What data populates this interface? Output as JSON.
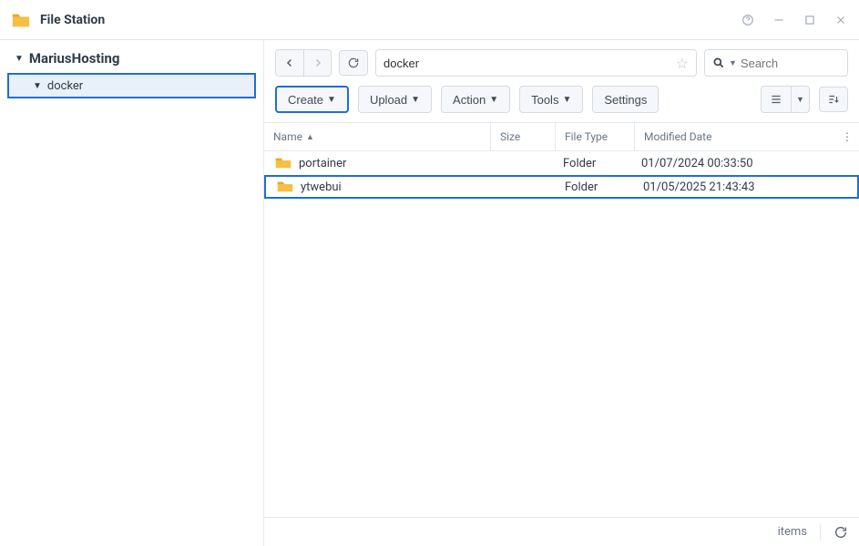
{
  "app": {
    "title": "File Station"
  },
  "tree": {
    "root_label": "MariusHosting",
    "selected_label": "docker"
  },
  "nav": {
    "path_value": "docker",
    "search_placeholder": "Search"
  },
  "toolbar": {
    "create_label": "Create",
    "upload_label": "Upload",
    "action_label": "Action",
    "tools_label": "Tools",
    "settings_label": "Settings"
  },
  "columns": {
    "name": "Name",
    "size": "Size",
    "type": "File Type",
    "modified": "Modified Date"
  },
  "rows": [
    {
      "name": "portainer",
      "type": "Folder",
      "modified": "01/07/2024 00:33:50",
      "selected": false
    },
    {
      "name": "ytwebui",
      "type": "Folder",
      "modified": "01/05/2025 21:43:43",
      "selected": true
    }
  ],
  "status": {
    "items_label": "items"
  },
  "icons": {
    "folder_colors": {
      "back": "#e9a62c",
      "front": "#f5c044"
    }
  }
}
